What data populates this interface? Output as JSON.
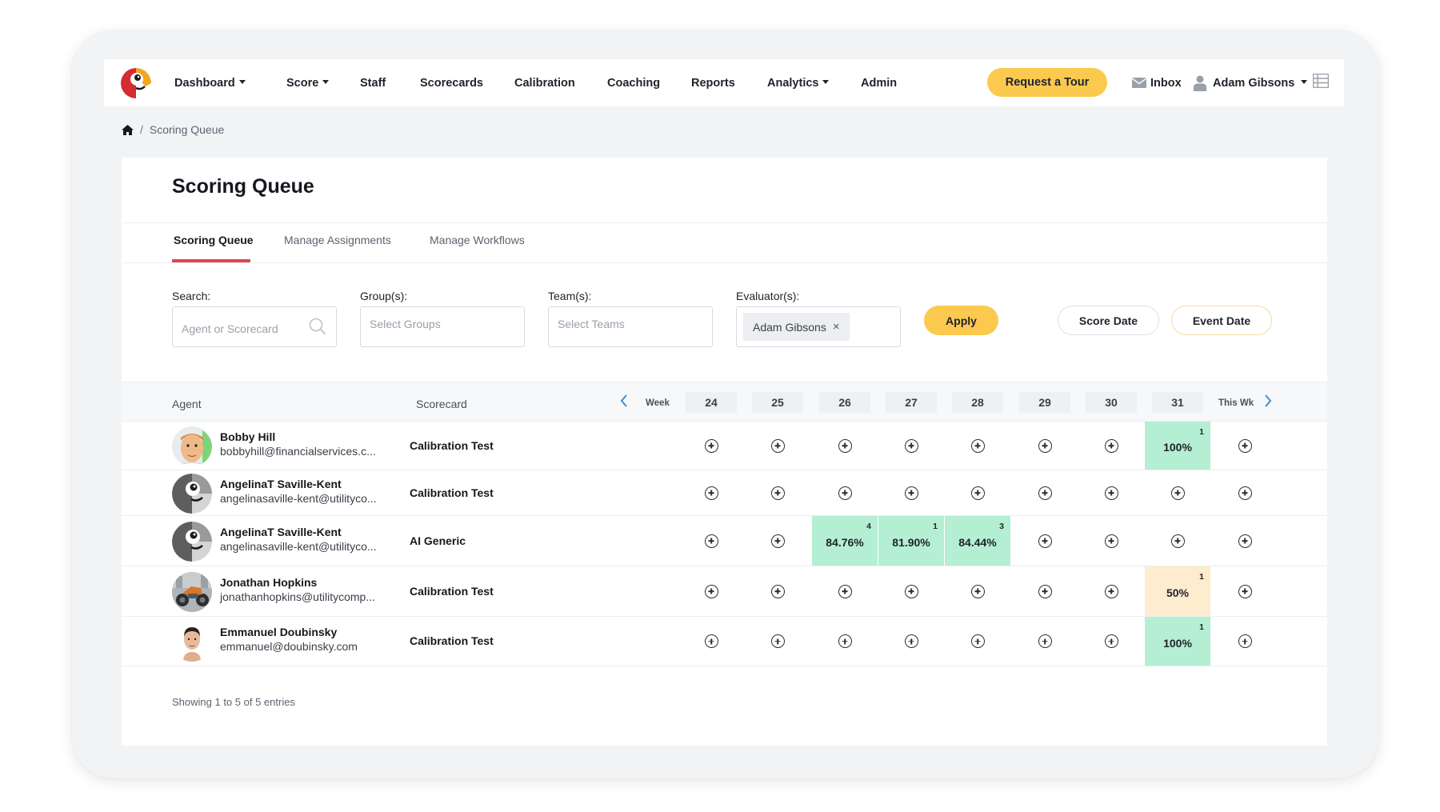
{
  "nav": {
    "items": [
      {
        "label": "Dashboard",
        "dropdown": true
      },
      {
        "label": "Score",
        "dropdown": true
      },
      {
        "label": "Staff",
        "dropdown": false
      },
      {
        "label": "Scorecards",
        "dropdown": false
      },
      {
        "label": "Calibration",
        "dropdown": false
      },
      {
        "label": "Coaching",
        "dropdown": false
      },
      {
        "label": "Reports",
        "dropdown": false
      },
      {
        "label": "Analytics",
        "dropdown": true
      },
      {
        "label": "Admin",
        "dropdown": false
      }
    ],
    "request_tour": "Request a Tour",
    "inbox": "Inbox",
    "user": "Adam Gibsons"
  },
  "breadcrumb": {
    "current": "Scoring Queue"
  },
  "page": {
    "title": "Scoring Queue"
  },
  "tabs": [
    {
      "label": "Scoring Queue",
      "active": true
    },
    {
      "label": "Manage Assignments",
      "active": false
    },
    {
      "label": "Manage Workflows",
      "active": false
    }
  ],
  "filters": {
    "search": {
      "label": "Search:",
      "placeholder": "Agent or Scorecard"
    },
    "groups": {
      "label": "Group(s):",
      "placeholder": "Select Groups"
    },
    "teams": {
      "label": "Team(s):",
      "placeholder": "Select Teams"
    },
    "evaluators": {
      "label": "Evaluator(s):",
      "selected": "Adam Gibsons",
      "remove": "×"
    },
    "apply": "Apply",
    "score_date": "Score Date",
    "event_date": "Event Date"
  },
  "table": {
    "headers": {
      "agent": "Agent",
      "scorecard": "Scorecard",
      "week": "Week",
      "this_week": "This Wk"
    },
    "weeks": [
      "24",
      "25",
      "26",
      "27",
      "28",
      "29",
      "30",
      "31"
    ],
    "rows": [
      {
        "name": "Bobby Hill",
        "email": "bobbyhill@financialservices.c...",
        "scorecard": "Calibration Test",
        "avatar": "cartoon-face",
        "cells": [
          null,
          null,
          null,
          null,
          null,
          null,
          null,
          {
            "value": "100%",
            "count": "1",
            "status": "good"
          },
          null
        ]
      },
      {
        "name": "AngelinaT Saville-Kent",
        "email": "angelinasaville-kent@utilityco...",
        "scorecard": "Calibration Test",
        "avatar": "parrot-gray",
        "cells": [
          null,
          null,
          null,
          null,
          null,
          null,
          null,
          null,
          null
        ]
      },
      {
        "name": "AngelinaT Saville-Kent",
        "email": "angelinasaville-kent@utilityco...",
        "scorecard": "AI Generic",
        "avatar": "parrot-gray",
        "cells": [
          null,
          null,
          {
            "value": "84.76%",
            "count": "4",
            "status": "good"
          },
          {
            "value": "81.90%",
            "count": "1",
            "status": "good"
          },
          {
            "value": "84.44%",
            "count": "3",
            "status": "good"
          },
          null,
          null,
          null,
          null
        ]
      },
      {
        "name": "Jonathan Hopkins",
        "email": "jonathanhopkins@utilitycomp...",
        "scorecard": "Calibration Test",
        "avatar": "motorcycle-photo",
        "cells": [
          null,
          null,
          null,
          null,
          null,
          null,
          null,
          {
            "value": "50%",
            "count": "1",
            "status": "warn"
          },
          null
        ]
      },
      {
        "name": "Emmanuel Doubinsky",
        "email": "emmanuel@doubinsky.com",
        "scorecard": "Calibration Test",
        "avatar": "person-photo",
        "cells": [
          null,
          null,
          null,
          null,
          null,
          null,
          null,
          {
            "value": "100%",
            "count": "1",
            "status": "good"
          },
          null
        ]
      }
    ],
    "footer": "Showing 1 to 5 of 5 entries"
  },
  "colors": {
    "accent_yellow": "#fcc94f",
    "tab_underline": "#e3424f",
    "good_cell": "#b5efd3",
    "warn_cell": "#fdeccd",
    "chevron_blue": "#3d8fd6"
  }
}
